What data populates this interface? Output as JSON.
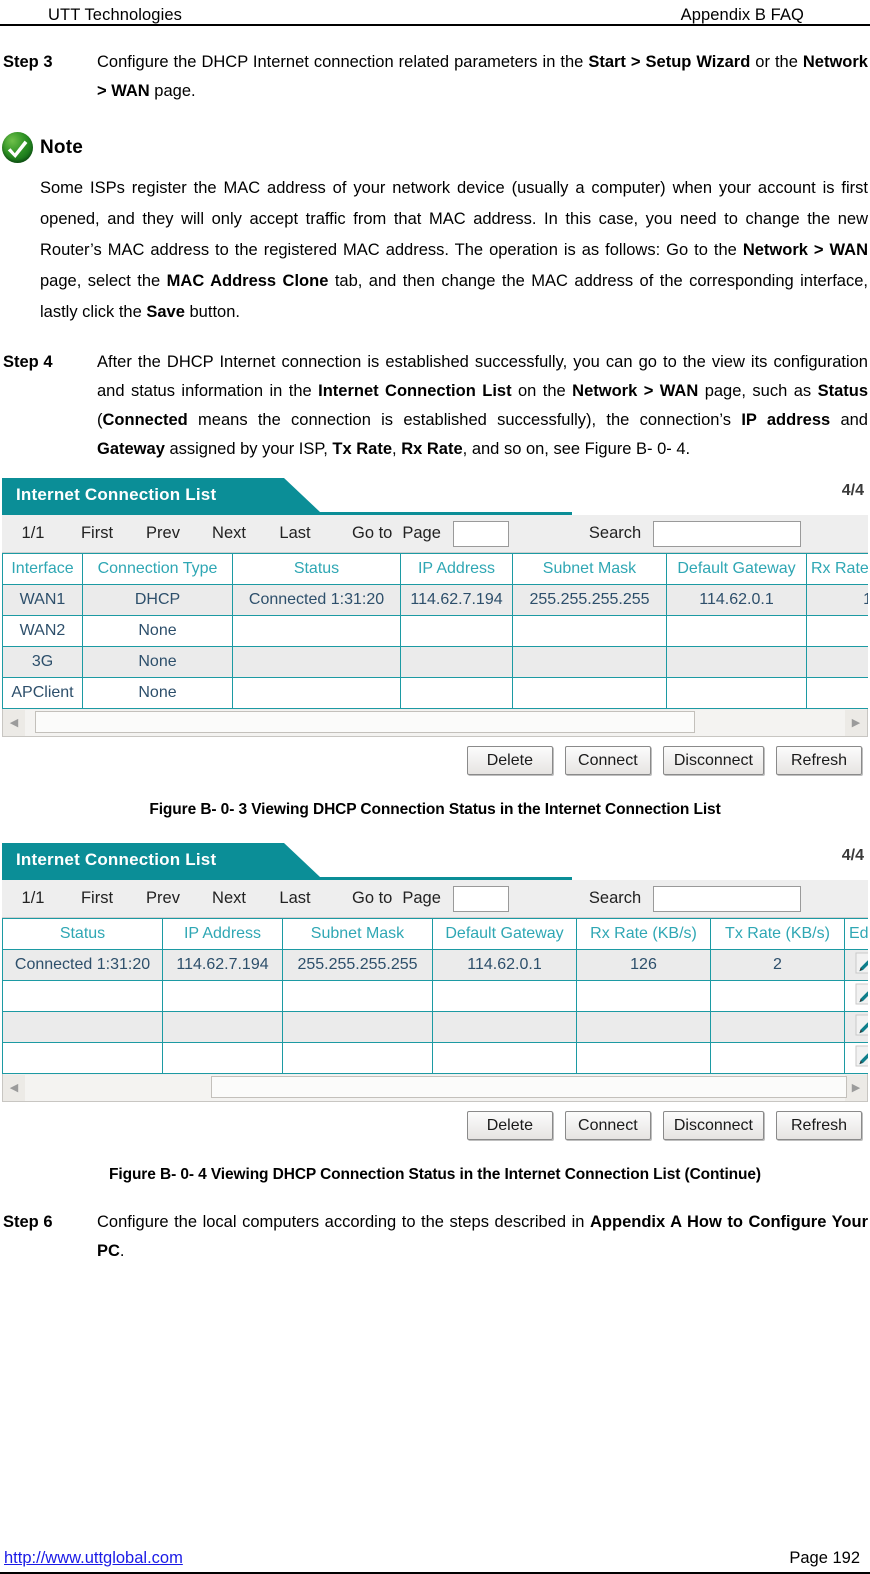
{
  "header": {
    "left": "UTT Technologies",
    "right": "Appendix B FAQ"
  },
  "steps": {
    "step3": {
      "label": "Step 3",
      "text_1": "Configure the DHCP Internet connection related parameters in the ",
      "bold_1": "Start > Setup Wizard",
      "text_2": " or the ",
      "bold_2": "Network > WAN",
      "text_3": " page."
    },
    "step4": {
      "label": "Step 4",
      "text_1": "After the DHCP Internet connection is established successfully, you can go to the view its configuration and status information in the ",
      "bold_1": "Internet Connection List",
      "text_2": " on the ",
      "bold_2": "Network > WAN",
      "text_3": " page, such as ",
      "bold_3": "Status",
      "text_4": " (",
      "bold_4": "Connected",
      "text_5": " means the connection is established successfully), the connection’s ",
      "bold_5": "IP address",
      "text_6": " and ",
      "bold_6": "Gateway",
      "text_7": " assigned by your ISP, ",
      "bold_7": "Tx Rate",
      "text_8": ", ",
      "bold_8": "Rx Rate",
      "text_9": ", and so on, see Figure B- 0- 4."
    },
    "step6": {
      "label": "Step 6",
      "text_1": "Configure the local computers according to the steps described in ",
      "bold_1": "Appendix A How to Configure Your PC",
      "text_2": "."
    }
  },
  "note": {
    "icon": "green-check-icon",
    "title": "Note",
    "text_1": "Some ISPs register the MAC address of your network device (usually a computer) when your account is first opened, and they will only accept traffic from that MAC address. In this case, you need to change the new Router’s MAC address to the registered MAC address. The operation is as follows: Go to the ",
    "bold_1": "Network > WAN",
    "text_2": " page, select the ",
    "bold_2": "MAC Address Clone",
    "text_3": " tab, and then change the MAC address of the corresponding interface, lastly click the ",
    "bold_3": "Save",
    "text_4": " button."
  },
  "colors": {
    "teal_banner": "#0b8e97",
    "table_border": "#1c9aa3",
    "header_text": "#2fa7b4",
    "cell_text": "#2d4f6b",
    "none_red": "#f0322e",
    "link_blue": "#1a1ae6",
    "row_alt": "#ebebeb"
  },
  "figure1": {
    "panel_title": "Internet Connection List",
    "count": "4/4",
    "toolbar": {
      "page_indicator": "1/1",
      "first": "First",
      "prev": "Prev",
      "next": "Next",
      "last": "Last",
      "goto": "Go to",
      "page": "Page",
      "page_input_value": "",
      "search_label": "Search",
      "search_input_value": ""
    },
    "columns": [
      "Interface",
      "Connection Type",
      "Status",
      "IP Address",
      "Subnet Mask",
      "Default Gateway",
      "Rx Rate"
    ],
    "rows": [
      [
        "WAN1",
        "DHCP",
        "Connected 1:31:20",
        "114.62.7.194",
        "255.255.255.255",
        "114.62.0.1",
        "1"
      ],
      [
        "WAN2",
        "None",
        "",
        "",
        "",
        "",
        ""
      ],
      [
        "3G",
        "None",
        "",
        "",
        "",
        "",
        ""
      ],
      [
        "APClient",
        "None",
        "",
        "",
        "",
        "",
        ""
      ]
    ],
    "buttons": [
      "Delete",
      "Connect",
      "Disconnect",
      "Refresh"
    ],
    "caption": "Figure B- 0- 3 Viewing DHCP Connection Status in the Internet Connection List"
  },
  "figure2": {
    "panel_title": "Internet Connection List",
    "count": "4/4",
    "toolbar": {
      "page_indicator": "1/1",
      "first": "First",
      "prev": "Prev",
      "next": "Next",
      "last": "Last",
      "goto": "Go to",
      "page": "Page",
      "page_input_value": "",
      "search_label": "Search",
      "search_input_value": ""
    },
    "columns": [
      "Status",
      "IP Address",
      "Subnet Mask",
      "Default Gateway",
      "Rx Rate (KB/s)",
      "Tx Rate (KB/s)",
      "Edit"
    ],
    "rows": [
      [
        "Connected 1:31:20",
        "114.62.7.194",
        "255.255.255.255",
        "114.62.0.1",
        "126",
        "2",
        "edit-pencil-icon"
      ],
      [
        "",
        "",
        "",
        "",
        "",
        "",
        "edit-pencil-icon"
      ],
      [
        "",
        "",
        "",
        "",
        "",
        "",
        "edit-pencil-icon"
      ],
      [
        "",
        "",
        "",
        "",
        "",
        "",
        "edit-pencil-icon"
      ]
    ],
    "buttons": [
      "Delete",
      "Connect",
      "Disconnect",
      "Refresh"
    ],
    "caption": "Figure B- 0- 4 Viewing DHCP Connection Status in the Internet Connection List (Continue)"
  },
  "footer": {
    "url": "http://www.uttglobal.com",
    "page": "Page 192"
  }
}
